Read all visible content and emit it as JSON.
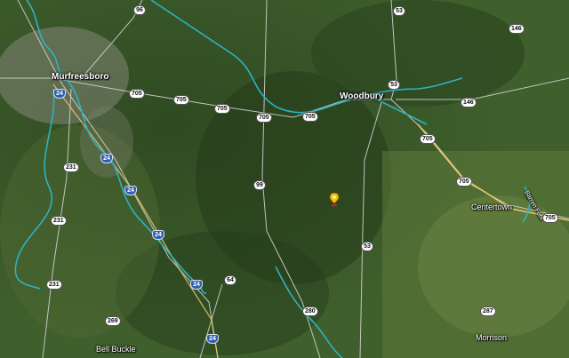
{
  "places": {
    "murfreesboro": "Murfreesboro",
    "woodbury": "Woodbury",
    "centertown": "Centertown",
    "bell_buckle": "Bell Buckle",
    "morrison": "Morrison",
    "river_label": "Barren Fork"
  },
  "shields": {
    "s96": "96",
    "s53a": "53",
    "s146a": "146",
    "s53b": "53",
    "s705a": "705",
    "s705b": "705",
    "s705c": "705",
    "s705d": "705",
    "s705e": "705",
    "s705f": "705",
    "s705g": "705",
    "s705h": "705",
    "s146b": "146",
    "s231a": "231",
    "s231b": "231",
    "s231c": "231",
    "s99": "99",
    "s53c": "53",
    "s64": "64",
    "s280": "280",
    "s269": "269",
    "s287": "287",
    "i24a": "24",
    "i24b": "24",
    "i24c": "24",
    "i24d": "24",
    "i24e": "24",
    "i24f": "24"
  },
  "colors": {
    "river": "#2bb3c4",
    "road": "#d9d9d9",
    "highway": "#e8c66a",
    "pin": "#f2c200"
  },
  "icons": {
    "pin": "map-pin-icon"
  }
}
